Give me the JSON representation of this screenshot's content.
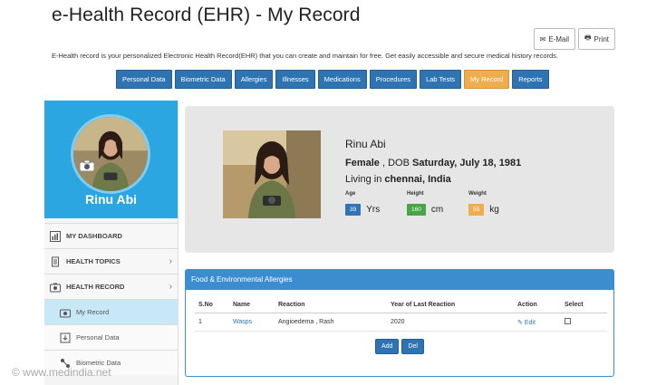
{
  "header": {
    "title": "e-Health Record (EHR) - My Record",
    "email_label": "E-Mail",
    "print_label": "Print",
    "tagline": "E-Health record is your personalized Electronic Health Record(EHR) that you can create and maintain for free. Get easily accessible and secure medical history records."
  },
  "tabs": [
    {
      "label": "Personal Data"
    },
    {
      "label": "Biometric Data"
    },
    {
      "label": "Allergies"
    },
    {
      "label": "Illnesses"
    },
    {
      "label": "Medications"
    },
    {
      "label": "Procedures"
    },
    {
      "label": "Lab Tests"
    },
    {
      "label": "My Record",
      "active": true
    },
    {
      "label": "Reports"
    }
  ],
  "sidebar": {
    "profile_name": "Rinu Abi",
    "items": [
      {
        "label": "MY DASHBOARD"
      },
      {
        "label": "HEALTH TOPICS"
      },
      {
        "label": "HEALTH RECORD"
      },
      {
        "label": "My Record"
      },
      {
        "label": "Personal Data"
      },
      {
        "label": "Biometric Data"
      }
    ]
  },
  "profile": {
    "name": "Rinu Abi",
    "gender": "Female",
    "dob_prefix": ", DOB",
    "dob": "Saturday, July 18, 1981",
    "living_prefix": "Living in",
    "location": "chennai, India",
    "age_label": "Age",
    "age_value": "39",
    "age_unit": "Yrs",
    "height_label": "Height",
    "height_value": "160",
    "height_unit": "cm",
    "weight_label": "Weight",
    "weight_value": "55",
    "weight_unit": "kg"
  },
  "allergies": {
    "title": "Food & Environmental Allergies",
    "columns": [
      "S.No",
      "Name",
      "Reaction",
      "Year of Last Reaction",
      "Action",
      "Select"
    ],
    "rows": [
      {
        "sno": "1",
        "name": "Wasps",
        "reaction": "Angioedema , Rash",
        "year": "2020",
        "action": "Edit"
      }
    ],
    "add_label": "Add",
    "del_label": "Del"
  },
  "watermark": "© www.medindia.net",
  "colors": {
    "primary": "#2f74b2",
    "active_tab": "#f0ad4e",
    "sidebar_profile": "#2ba6e1",
    "green": "#47a447"
  }
}
